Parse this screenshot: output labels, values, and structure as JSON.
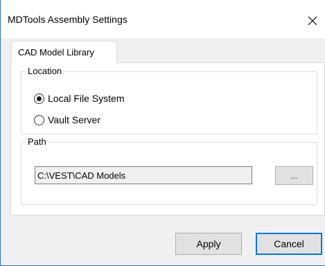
{
  "window": {
    "title": "MDTools Assembly Settings",
    "accent_color": "#0078d7"
  },
  "tabs": [
    {
      "label": "CAD Model Library",
      "selected": true
    }
  ],
  "location_group": {
    "label": "Location",
    "options": [
      {
        "label": "Local File System",
        "checked": true
      },
      {
        "label": "Vault Server",
        "checked": false
      }
    ]
  },
  "path_group": {
    "label": "Path",
    "value": "C:\\VEST\\CAD Models",
    "browse_label": "..."
  },
  "footer": {
    "apply_label": "Apply",
    "cancel_label": "Cancel"
  },
  "icons": {
    "close": "close-icon"
  }
}
